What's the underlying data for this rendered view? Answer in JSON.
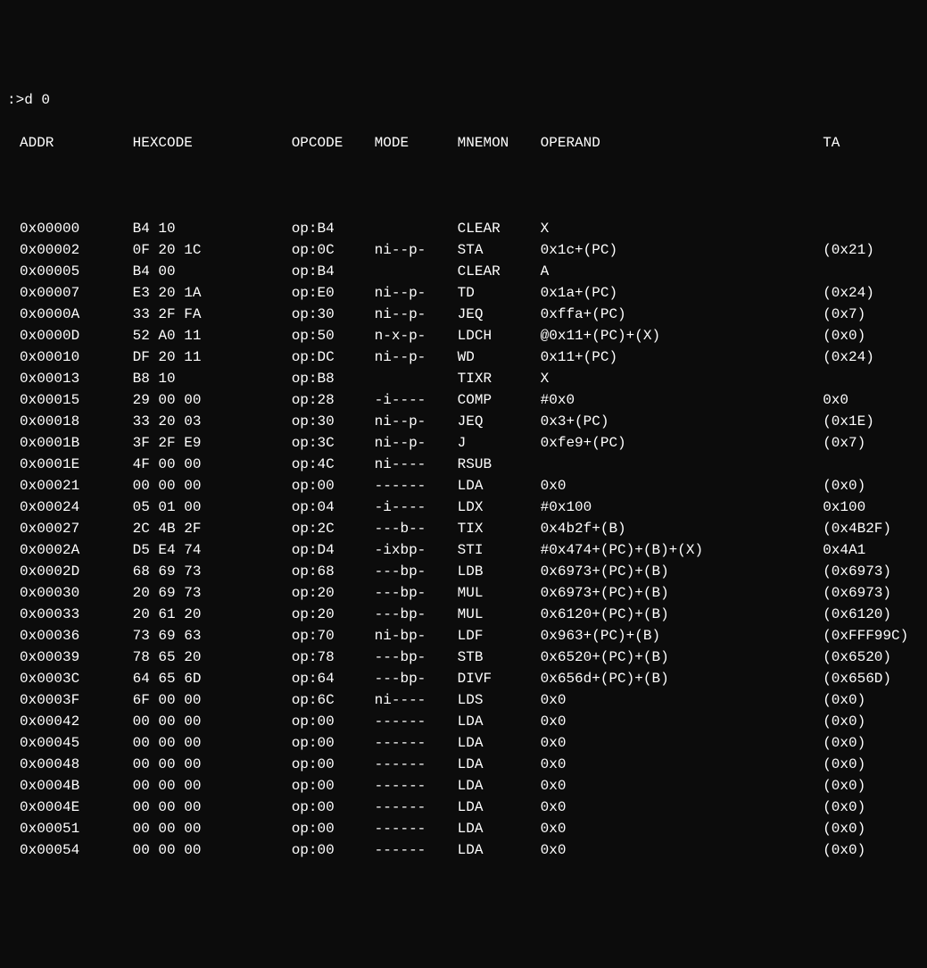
{
  "prompt": ":>d 0",
  "headers": {
    "addr": "ADDR",
    "hex": "HEXCODE",
    "op": "OPCODE",
    "mode": "MODE",
    "mnem": "MNEMON",
    "oper": "OPERAND",
    "ta": "TA"
  },
  "rows": [
    {
      "addr": "0x00000",
      "hex": "B4 10",
      "op": "op:B4",
      "mode": "",
      "mnem": "CLEAR",
      "oper": "X",
      "ta": ""
    },
    {
      "addr": "0x00002",
      "hex": "0F 20 1C",
      "op": "op:0C",
      "mode": "ni--p-",
      "mnem": "STA",
      "oper": "0x1c+(PC)",
      "ta": "(0x21)"
    },
    {
      "addr": "0x00005",
      "hex": "B4 00",
      "op": "op:B4",
      "mode": "",
      "mnem": "CLEAR",
      "oper": "A",
      "ta": ""
    },
    {
      "addr": "0x00007",
      "hex": "E3 20 1A",
      "op": "op:E0",
      "mode": "ni--p-",
      "mnem": "TD",
      "oper": "0x1a+(PC)",
      "ta": "(0x24)"
    },
    {
      "addr": "0x0000A",
      "hex": "33 2F FA",
      "op": "op:30",
      "mode": "ni--p-",
      "mnem": "JEQ",
      "oper": "0xffa+(PC)",
      "ta": "(0x7)"
    },
    {
      "addr": "0x0000D",
      "hex": "52 A0 11",
      "op": "op:50",
      "mode": "n-x-p-",
      "mnem": "LDCH",
      "oper": "@0x11+(PC)+(X)",
      "ta": "(0x0)"
    },
    {
      "addr": "0x00010",
      "hex": "DF 20 11",
      "op": "op:DC",
      "mode": "ni--p-",
      "mnem": "WD",
      "oper": "0x11+(PC)",
      "ta": "(0x24)"
    },
    {
      "addr": "0x00013",
      "hex": "B8 10",
      "op": "op:B8",
      "mode": "",
      "mnem": "TIXR",
      "oper": "X",
      "ta": ""
    },
    {
      "addr": "0x00015",
      "hex": "29 00 00",
      "op": "op:28",
      "mode": "-i----",
      "mnem": "COMP",
      "oper": "#0x0",
      "ta": "0x0"
    },
    {
      "addr": "0x00018",
      "hex": "33 20 03",
      "op": "op:30",
      "mode": "ni--p-",
      "mnem": "JEQ",
      "oper": "0x3+(PC)",
      "ta": "(0x1E)"
    },
    {
      "addr": "0x0001B",
      "hex": "3F 2F E9",
      "op": "op:3C",
      "mode": "ni--p-",
      "mnem": "J",
      "oper": "0xfe9+(PC)",
      "ta": "(0x7)"
    },
    {
      "addr": "0x0001E",
      "hex": "4F 00 00",
      "op": "op:4C",
      "mode": "ni----",
      "mnem": "RSUB",
      "oper": "",
      "ta": ""
    },
    {
      "addr": "0x00021",
      "hex": "00 00 00",
      "op": "op:00",
      "mode": "------",
      "mnem": "LDA",
      "oper": "0x0",
      "ta": "(0x0)"
    },
    {
      "addr": "0x00024",
      "hex": "05 01 00",
      "op": "op:04",
      "mode": "-i----",
      "mnem": "LDX",
      "oper": "#0x100",
      "ta": "0x100"
    },
    {
      "addr": "0x00027",
      "hex": "2C 4B 2F",
      "op": "op:2C",
      "mode": "---b--",
      "mnem": "TIX",
      "oper": "0x4b2f+(B)",
      "ta": "(0x4B2F)"
    },
    {
      "addr": "0x0002A",
      "hex": "D5 E4 74",
      "op": "op:D4",
      "mode": "-ixbp-",
      "mnem": "STI",
      "oper": "#0x474+(PC)+(B)+(X)",
      "ta": "0x4A1"
    },
    {
      "addr": "0x0002D",
      "hex": "68 69 73",
      "op": "op:68",
      "mode": "---bp-",
      "mnem": "LDB",
      "oper": "0x6973+(PC)+(B)",
      "ta": "(0x6973)"
    },
    {
      "addr": "0x00030",
      "hex": "20 69 73",
      "op": "op:20",
      "mode": "---bp-",
      "mnem": "MUL",
      "oper": "0x6973+(PC)+(B)",
      "ta": "(0x6973)"
    },
    {
      "addr": "0x00033",
      "hex": "20 61 20",
      "op": "op:20",
      "mode": "---bp-",
      "mnem": "MUL",
      "oper": "0x6120+(PC)+(B)",
      "ta": "(0x6120)"
    },
    {
      "addr": "0x00036",
      "hex": "73 69 63",
      "op": "op:70",
      "mode": "ni-bp-",
      "mnem": "LDF",
      "oper": "0x963+(PC)+(B)",
      "ta": "(0xFFF99C)"
    },
    {
      "addr": "0x00039",
      "hex": "78 65 20",
      "op": "op:78",
      "mode": "---bp-",
      "mnem": "STB",
      "oper": "0x6520+(PC)+(B)",
      "ta": "(0x6520)"
    },
    {
      "addr": "0x0003C",
      "hex": "64 65 6D",
      "op": "op:64",
      "mode": "---bp-",
      "mnem": "DIVF",
      "oper": "0x656d+(PC)+(B)",
      "ta": "(0x656D)"
    },
    {
      "addr": "0x0003F",
      "hex": "6F 00 00",
      "op": "op:6C",
      "mode": "ni----",
      "mnem": "LDS",
      "oper": "0x0",
      "ta": "(0x0)"
    },
    {
      "addr": "0x00042",
      "hex": "00 00 00",
      "op": "op:00",
      "mode": "------",
      "mnem": "LDA",
      "oper": "0x0",
      "ta": "(0x0)"
    },
    {
      "addr": "0x00045",
      "hex": "00 00 00",
      "op": "op:00",
      "mode": "------",
      "mnem": "LDA",
      "oper": "0x0",
      "ta": "(0x0)"
    },
    {
      "addr": "0x00048",
      "hex": "00 00 00",
      "op": "op:00",
      "mode": "------",
      "mnem": "LDA",
      "oper": "0x0",
      "ta": "(0x0)"
    },
    {
      "addr": "0x0004B",
      "hex": "00 00 00",
      "op": "op:00",
      "mode": "------",
      "mnem": "LDA",
      "oper": "0x0",
      "ta": "(0x0)"
    },
    {
      "addr": "0x0004E",
      "hex": "00 00 00",
      "op": "op:00",
      "mode": "------",
      "mnem": "LDA",
      "oper": "0x0",
      "ta": "(0x0)"
    },
    {
      "addr": "0x00051",
      "hex": "00 00 00",
      "op": "op:00",
      "mode": "------",
      "mnem": "LDA",
      "oper": "0x0",
      "ta": "(0x0)"
    },
    {
      "addr": "0x00054",
      "hex": "00 00 00",
      "op": "op:00",
      "mode": "------",
      "mnem": "LDA",
      "oper": "0x0",
      "ta": "(0x0)"
    }
  ]
}
